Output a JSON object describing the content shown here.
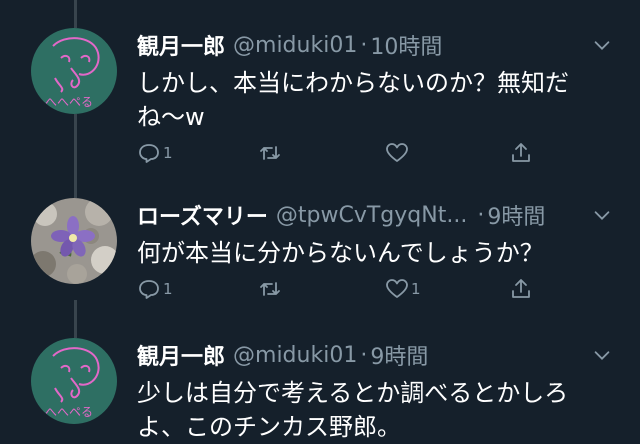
{
  "tweets": [
    {
      "display_name": "観月一郎",
      "handle": "@miduki01",
      "dot": "·",
      "time": "10時間",
      "text": "しかし、本当にわからないのか？無知だね〜w",
      "reply_count": "1",
      "retweet_count": "",
      "like_count": "",
      "avatar_icon": "face-doodle-avatar",
      "avatar_text": "へへペる"
    },
    {
      "display_name": "ローズマリー",
      "handle": "@tpwCvTgyqNt...",
      "dot": "·",
      "time": "9時間",
      "text": "何が本当に分からないんでしょうか？",
      "reply_count": "1",
      "retweet_count": "",
      "like_count": "1",
      "avatar_icon": "purple-flower-avatar"
    },
    {
      "display_name": "観月一郎",
      "handle": "@miduki01",
      "dot": "·",
      "time": "9時間",
      "text": "少しは自分で考えるとか調べるとかしろよ、このチンカス野郎。",
      "reply_count": "",
      "retweet_count": "",
      "like_count": "",
      "avatar_icon": "face-doodle-avatar",
      "avatar_text": "へへペる"
    }
  ],
  "colors": {
    "background": "#15202b",
    "secondary_text": "#8899a6",
    "thread_line": "#38444d",
    "avatar_teal": "#2e6f63",
    "doodle_pink": "#e268c8"
  },
  "icons": {
    "reply": "reply-icon",
    "retweet": "retweet-icon",
    "like": "heart-icon",
    "share": "share-icon",
    "menu": "chevron-down-icon"
  }
}
